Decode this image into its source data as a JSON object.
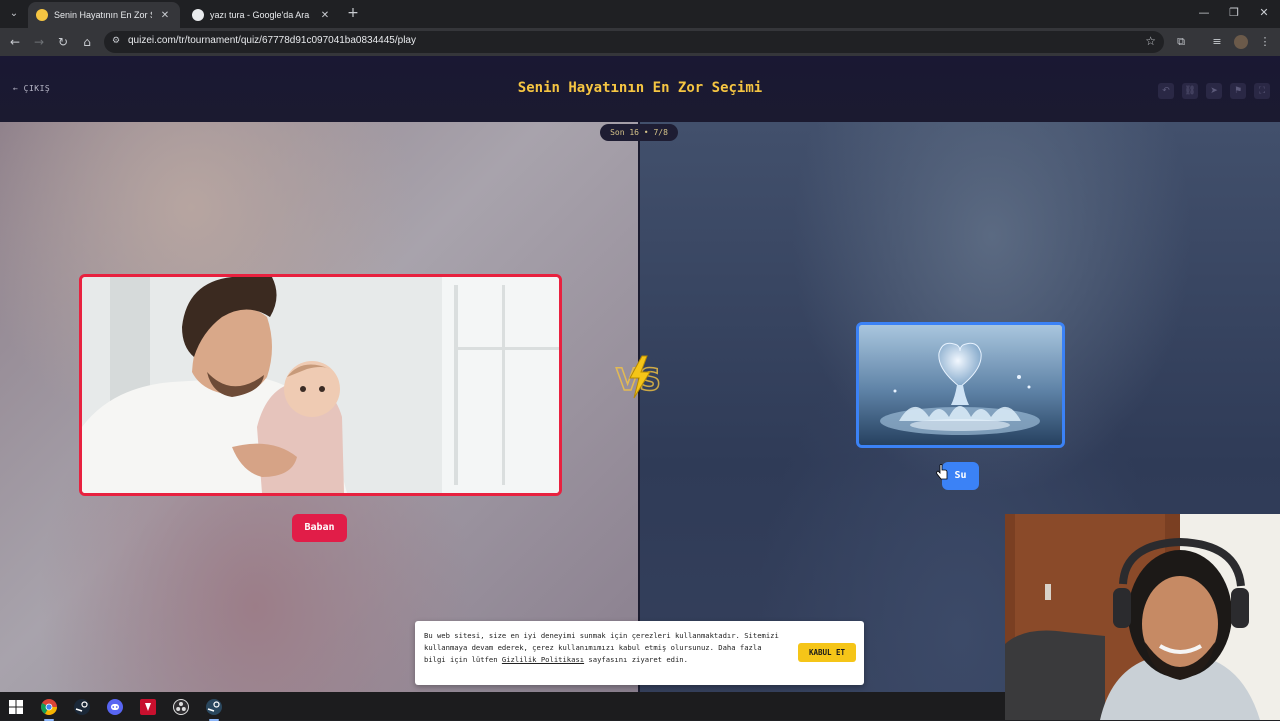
{
  "browser": {
    "tabs": [
      {
        "title": "Senin Hayatının En Zor Seçimi -",
        "active": true,
        "favicon_color": "#f5c542"
      },
      {
        "title": "yazı tura - Google'da Ara",
        "active": false,
        "favicon_color": "#e8eaed"
      }
    ],
    "url": "quizei.com/tr/tournament/quiz/67778d91c097041ba0834445/play"
  },
  "header": {
    "exit_label": "ÇIKIŞ",
    "title": "Senin Hayatının En Zor Seçimi"
  },
  "round": {
    "label": "Son 16 • 7/8"
  },
  "choices": {
    "left": {
      "label": "Baban",
      "accent": "#e11d48",
      "image": "father-with-baby"
    },
    "right": {
      "label": "Su",
      "accent": "#3b82f6",
      "image": "heart-shaped-water-splash"
    }
  },
  "cookie": {
    "text_before_link": "Bu web sitesi, size en iyi deneyimi sunmak için çerezleri kullanmaktadır. Sitemizi kullanmaya devam ederek, çerez kullanımımızı kabul etmiş olursunuz. Daha fazla bilgi için lütfen ",
    "link_text": "Gizlilik Politikası",
    "text_after_link": " sayfasını ziyaret edin.",
    "accept_label": "KABUL ET"
  },
  "colors": {
    "title": "#f5c542",
    "page_bg": "#1a1b2e",
    "left_accent": "#e11d48",
    "right_accent": "#3b82f6",
    "accept_button": "#f5c518"
  }
}
